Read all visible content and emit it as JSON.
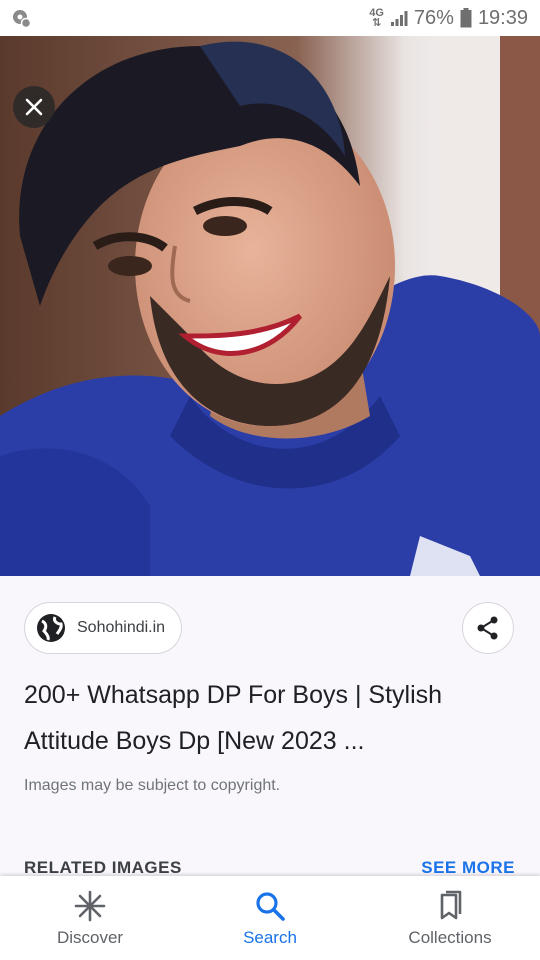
{
  "status_bar": {
    "network_top": "4G",
    "network_bottom": "⇅",
    "battery_percent": "76%",
    "time": "19:39"
  },
  "viewer": {
    "close_icon": "close-icon",
    "image_subject": "portrait"
  },
  "info": {
    "source_label": "Sohohindi.in",
    "title_line1": "200+ Whatsapp DP For Boys | Stylish",
    "title_line2": "Attitude Boys Dp [New 2023 ...",
    "copyright": "Images may be subject to copyright.",
    "related_header": "RELATED IMAGES",
    "see_more": "SEE MORE"
  },
  "bottom_nav": {
    "items": [
      {
        "label": "Discover",
        "icon": "asterisk-icon",
        "active": false
      },
      {
        "label": "Search",
        "icon": "search-icon",
        "active": true
      },
      {
        "label": "Collections",
        "icon": "bookmark-icon",
        "active": false
      }
    ]
  },
  "colors": {
    "accent": "#1a73e8",
    "panel_bg": "#f9f7fc",
    "hoodie": "#2b3ea8"
  }
}
